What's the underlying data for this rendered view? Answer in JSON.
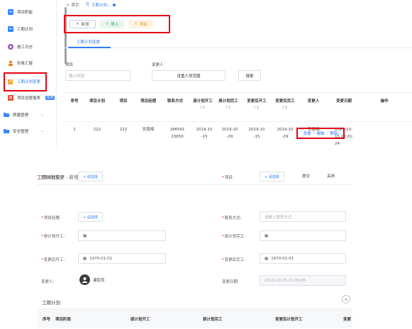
{
  "sidebar": {
    "items": [
      {
        "label": "项目职能",
        "icon": "grid-icon",
        "color": "#3a86ff"
      },
      {
        "label": "工期计划",
        "icon": "calendar-icon",
        "color": "#3a86ff"
      },
      {
        "label": "施工日志",
        "icon": "log-icon",
        "color": "#9b59b6"
      },
      {
        "label": "形象汇报",
        "icon": "person-icon",
        "color": "#e67e22"
      },
      {
        "label": "工期计划变更",
        "icon": "edit-icon",
        "color": "#f5a623"
      },
      {
        "label": "项目进度报表",
        "badge": "新增",
        "icon": "report-icon",
        "color": "#e74c3c"
      },
      {
        "label": "质量管理",
        "icon": "folder-icon",
        "color": "#3a86ff"
      },
      {
        "label": "安全管理",
        "icon": "folder-icon",
        "color": "#3a86ff"
      }
    ]
  },
  "tabs": [
    {
      "label": "首页",
      "active": false
    },
    {
      "label": "工期计划...",
      "active": true
    }
  ],
  "toolbar": {
    "add": "新增",
    "import": "导入",
    "export": "导出"
  },
  "subtab": {
    "label": "工期计划变更"
  },
  "filters": {
    "project_label": "项目",
    "project_placeholder": "输入内容",
    "changer_label": "变更人",
    "changer_button": "设置人员范围",
    "search_button": "搜索"
  },
  "table": {
    "headers": [
      "序号",
      "项目计划",
      "项目",
      "项目经理",
      "联系方式",
      "原计划开工",
      "原计划完工",
      "变更后开工",
      "变更后完工",
      "变更人",
      "变更日期",
      "操作"
    ],
    "row": [
      "1",
      "222",
      "222",
      "安喜梅",
      "18654123650",
      "2019-10-15",
      "2019-10-29",
      "2019-10-15",
      "2019-10-29",
      "安喜梅",
      "2019-10-15 11:01:24"
    ],
    "ops": {
      "view": "查看",
      "edit": "编辑",
      "delete": "删除"
    }
  },
  "form": {
    "title": "工期计划变更",
    "subtitle": "新增",
    "submit": "提交",
    "close": "关闭",
    "project_plan_label": "项目计划:",
    "project_label": "项目:",
    "manager_label": "项目经理:",
    "contact_label": "联系方式:",
    "orig_start_label": "原计划开工:",
    "orig_end_label": "原计划完工:",
    "new_start_label": "变更后开工:",
    "new_end_label": "变更后完工:",
    "changer_label": "变更人:",
    "change_date_label": "变更日期:",
    "pick_button": "+ 请选择",
    "contact_placeholder": "请输入联系方式",
    "new_start_value": "1970-01-01",
    "new_end_value": "1970-01-01",
    "changer_name": "谭宏芳",
    "change_date_value": "2019-10-15 15:06:05",
    "section_title": "工期计划",
    "section_headers": [
      "序号",
      "项目阶段",
      "原计划开工",
      "原计划完工",
      "变更后计划开工",
      "变更"
    ]
  }
}
